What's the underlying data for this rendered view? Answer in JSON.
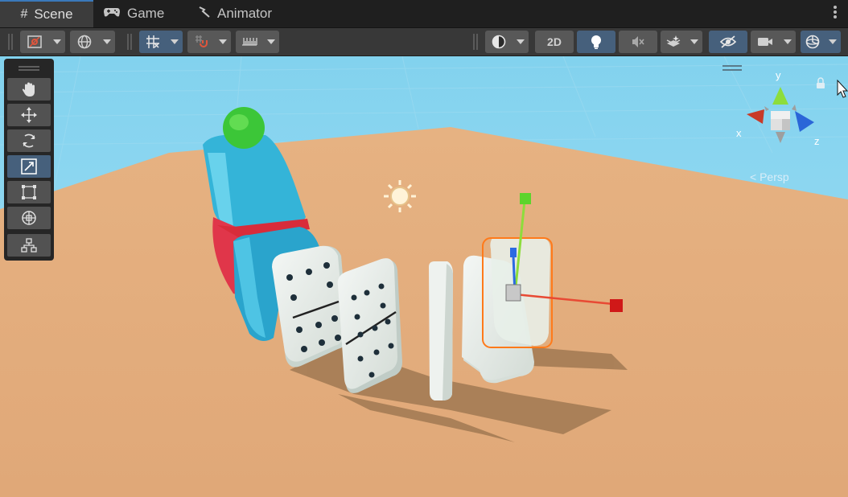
{
  "tabs": [
    {
      "label": "Scene",
      "icon": "#",
      "active": true
    },
    {
      "label": "Game",
      "icon": "gamepad-icon",
      "active": false
    },
    {
      "label": "Animator",
      "icon": "animator-icon",
      "active": false
    }
  ],
  "toolbar": {
    "mode_2d_label": "2D",
    "left_buttons": [
      "draw-mode",
      "scene-view-world",
      "grid-snapping",
      "increment-snap",
      "grid-visibility"
    ],
    "right_buttons": [
      "render-shading",
      "2d-toggle",
      "lighting",
      "audio",
      "effects",
      "scene-visibility",
      "camera",
      "gizmos"
    ]
  },
  "tools": [
    "View Tool",
    "Move Tool",
    "Rotate Tool",
    "Scale Tool",
    "Rect Tool",
    "Transform Tool",
    "Custom Tool"
  ],
  "orientation_gizmo": {
    "x_label": "x",
    "y_label": "y",
    "z_label": "z",
    "projection_label": "< Persp"
  },
  "colors": {
    "sky": "#84d4ec",
    "ground": "#e2ac7c",
    "selection": "#3a79bb",
    "axis_x": "#d83a2a",
    "axis_y": "#8ddd3c",
    "axis_z": "#2c6ae2"
  }
}
